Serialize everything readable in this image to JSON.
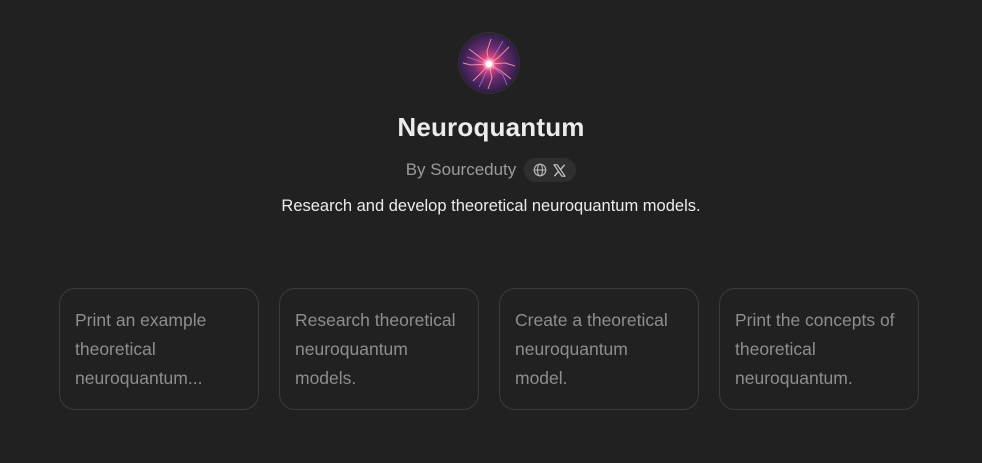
{
  "gpt": {
    "name": "Neuroquantum",
    "byline": "By Sourceduty",
    "description": "Research and develop theoretical neuroquantum models."
  },
  "social": {
    "icons": [
      "globe-icon",
      "x-icon"
    ]
  },
  "starters": [
    {
      "text": "Print an example theoretical neuroquantum..."
    },
    {
      "text": "Research theoretical neuroquantum models."
    },
    {
      "text": "Create a theoretical neuroquantum model."
    },
    {
      "text": "Print the concepts of theoretical neuroquantum."
    }
  ],
  "colors": {
    "background": "#212121",
    "card_border": "#3b3b3b",
    "muted_text": "#8e8e8e",
    "primary_text": "#ececec",
    "pill_bg": "#2f2f2f"
  }
}
